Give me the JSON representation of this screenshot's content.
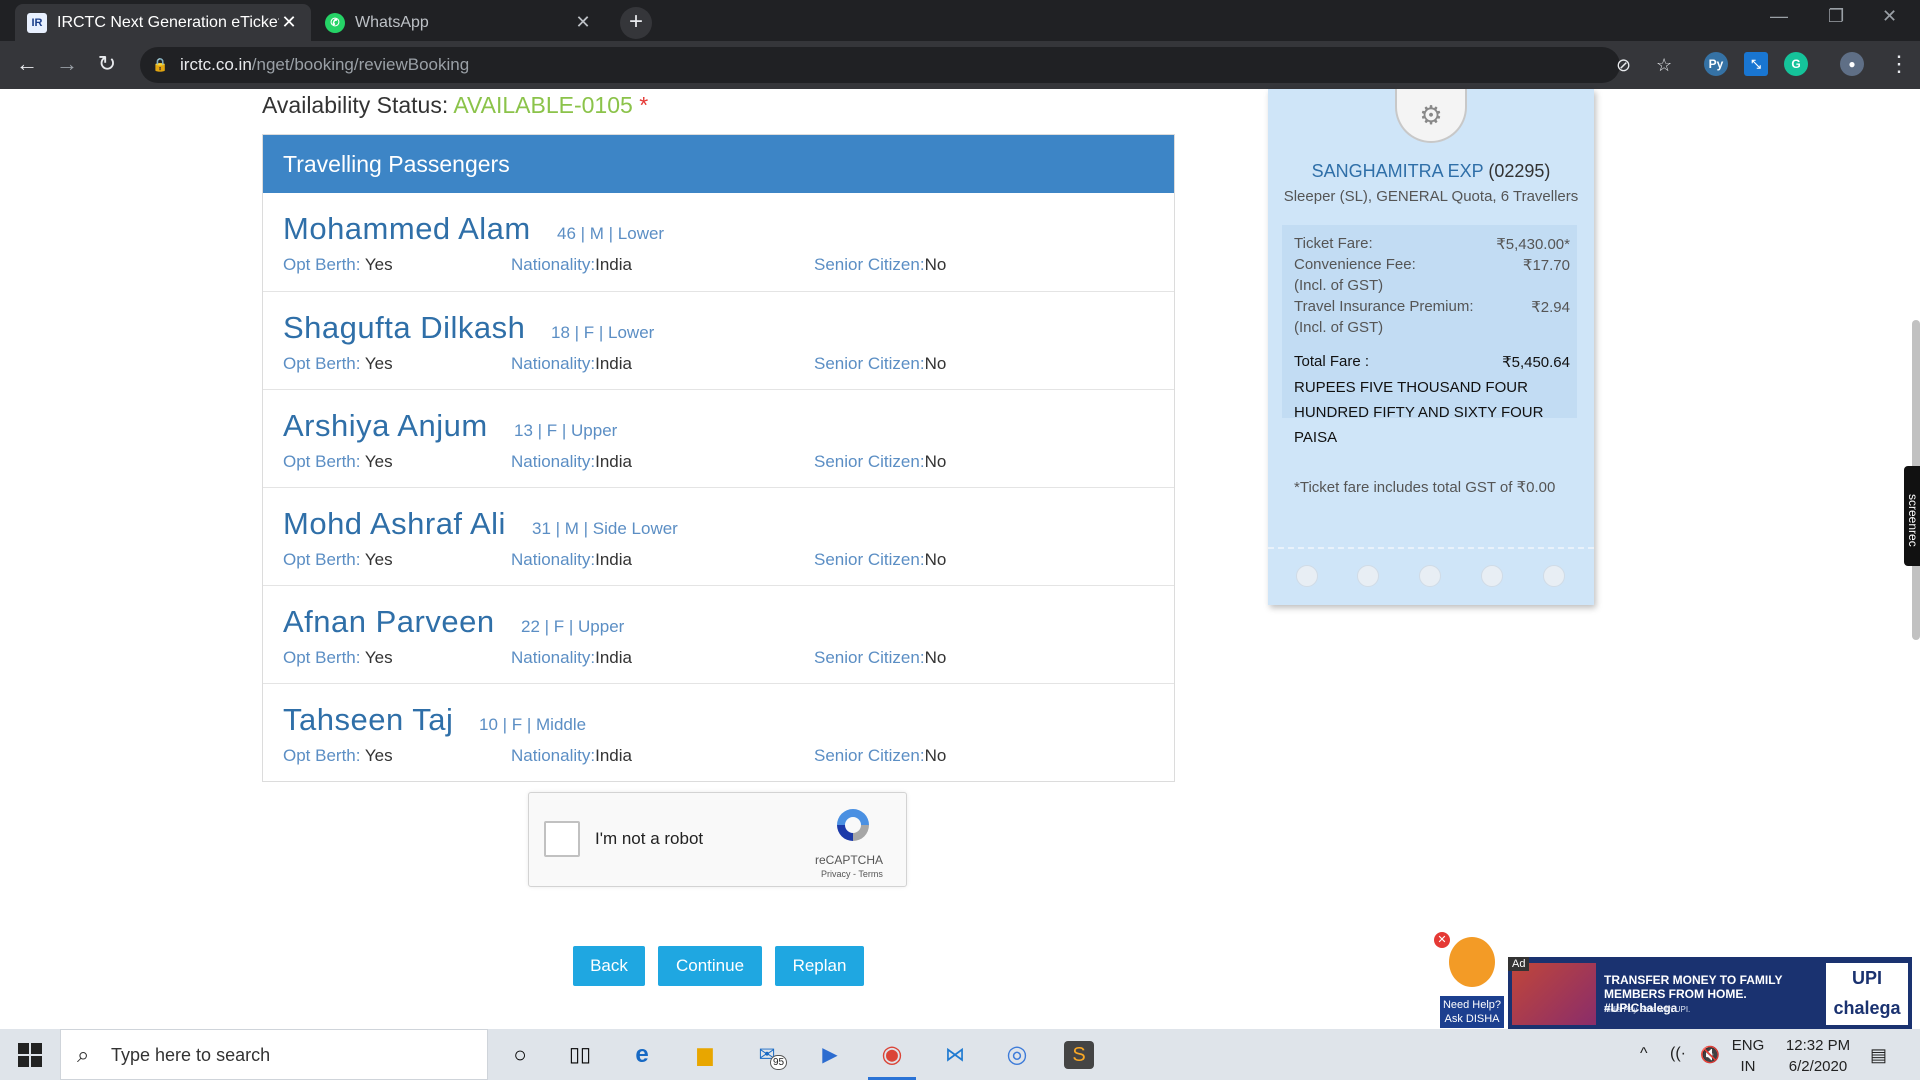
{
  "browser": {
    "tabs": [
      {
        "title": "IRCTC Next Generation eTicketing",
        "favicon": "irctc-icon",
        "active": true
      },
      {
        "title": "WhatsApp",
        "favicon": "whatsapp-icon",
        "active": false
      }
    ],
    "url_host": "irctc.co.in",
    "url_path": "/nget/booking/reviewBooking"
  },
  "availability": {
    "label": "Availability Status: ",
    "value": "AVAILABLE-0105",
    "marker": "*",
    "value_color": "#8bc34a"
  },
  "passengers_panel": {
    "heading": "Travelling Passengers",
    "opt_berth_label": "Opt Berth: ",
    "nationality_label": "Nationality:",
    "senior_label": "Senior Citizen:",
    "list": [
      {
        "name": "Mohammed Alam",
        "meta": "46 | M | Lower",
        "opt_berth": "Yes",
        "nationality": "India",
        "senior": "No"
      },
      {
        "name": "Shagufta Dilkash",
        "meta": "18 | F | Lower",
        "opt_berth": "Yes",
        "nationality": "India",
        "senior": "No"
      },
      {
        "name": "Arshiya Anjum",
        "meta": "13 | F | Upper",
        "opt_berth": "Yes",
        "nationality": "India",
        "senior": "No"
      },
      {
        "name": "Mohd Ashraf Ali",
        "meta": "31 | M | Side Lower",
        "opt_berth": "Yes",
        "nationality": "India",
        "senior": "No"
      },
      {
        "name": "Afnan Parveen",
        "meta": "22 | F | Upper",
        "opt_berth": "Yes",
        "nationality": "India",
        "senior": "No"
      },
      {
        "name": "Tahseen Taj",
        "meta": "10 | F | Middle",
        "opt_berth": "Yes",
        "nationality": "India",
        "senior": "No"
      }
    ]
  },
  "captcha": {
    "label": "I'm not a robot",
    "brand": "reCAPTCHA",
    "terms": "Privacy - Terms"
  },
  "actions": {
    "back": "Back",
    "continue": "Continue",
    "replan": "Replan",
    "button_color": "#1fa7e1"
  },
  "fare_card": {
    "train_name": "SANGHAMITRA EXP",
    "train_number": "(02295)",
    "class_info": "Sleeper (SL), GENERAL Quota, 6 Travellers",
    "ticket_fare_label": "Ticket Fare:",
    "ticket_fare": "₹5,430.00*",
    "convenience_label": "Convenience Fee:",
    "convenience_fee": "₹17.70",
    "incl_gst": "(Incl. of GST)",
    "insurance_label": "Travel Insurance Premium:",
    "insurance": "₹2.94",
    "total_label": "Total Fare :",
    "total": "₹5,450.64",
    "total_words": "RUPEES FIVE THOUSAND FOUR HUNDRED FIFTY AND SIXTY FOUR PAISA",
    "gst_note": "*Ticket fare includes total GST of ₹0.00"
  },
  "side_widgets": {
    "screenrec": "screenrec",
    "disha_help": "Need Help? Ask DISHA",
    "ad_tag": "Ad",
    "ad_headline": "TRANSFER MONEY TO FAMILY MEMBERS FROM HOME. #UPIChalega",
    "ad_sub": "India Pay Safe with UPI.",
    "ad_logo": "UPI chalega"
  },
  "taskbar": {
    "search_placeholder": "Type here to search",
    "mail_badge": "95",
    "lang_top": "ENG",
    "lang_bottom": "IN",
    "time": "12:32 PM",
    "date": "6/2/2020"
  }
}
